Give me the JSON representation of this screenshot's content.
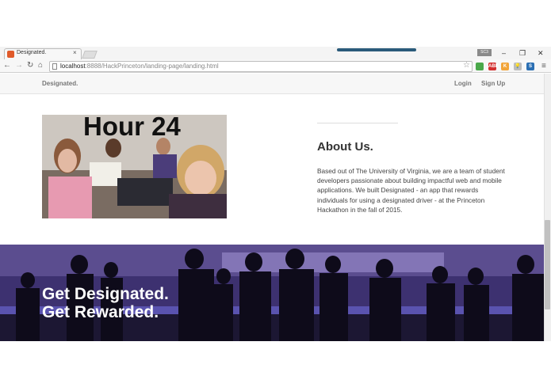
{
  "browser": {
    "tab_title": "Designated.",
    "tab_close": "×",
    "user_label": "SC3",
    "window_controls": [
      "–",
      "❐",
      "✕"
    ],
    "url_host": "localhost",
    "url_path": ":8888/HackPrinceton/landing-page/landing.html",
    "nav_icons": [
      "back-icon",
      "forward-icon",
      "reload-icon",
      "home-icon"
    ],
    "star_icon": "☆",
    "extensions": [
      {
        "name": "chrome-colors-extension-icon",
        "color": "#4aa84a",
        "label": ""
      },
      {
        "name": "adblock-extension-icon",
        "color": "#d32f2f",
        "label": "ABP"
      },
      {
        "name": "keep-extension-icon",
        "color": "#f2a53a",
        "label": "K"
      },
      {
        "name": "lightbulb-extension-icon",
        "color": "#bdbdbd",
        "label": "💡"
      },
      {
        "name": "s-extension-icon",
        "color": "#2b6fb3",
        "label": "S"
      }
    ],
    "menu_icon": "≡"
  },
  "navbar": {
    "brand": "Designated.",
    "login": "Login",
    "signup": "Sign Up"
  },
  "about": {
    "photo_caption": "Hour 24",
    "heading": "About Us.",
    "body": "Based out of The University of Virginia, we are a team of student developers passionate about building impactful web and mobile applications. We built Designated - an app that rewards individuals for using a designated driver - at the Princeton Hackathon in the fall of 2015."
  },
  "banner": {
    "line1": "Get Designated.",
    "line2": "Get Rewarded."
  }
}
